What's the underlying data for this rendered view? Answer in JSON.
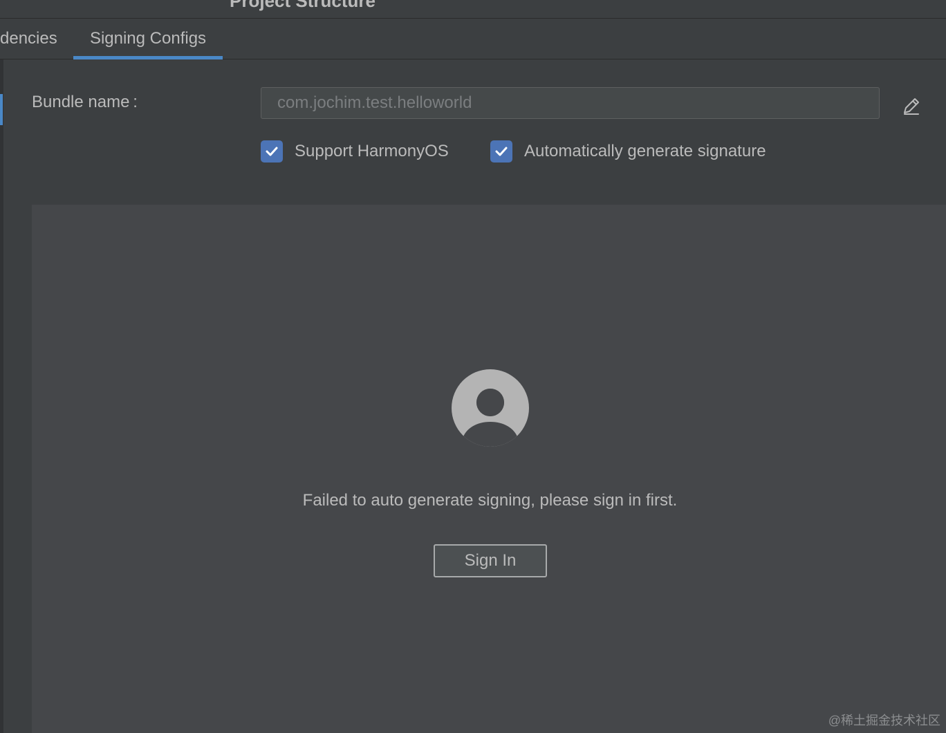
{
  "window": {
    "title": "Project Structure"
  },
  "tabs": [
    {
      "label": "dencies",
      "active": false
    },
    {
      "label": "Signing Configs",
      "active": true
    }
  ],
  "bundle": {
    "label": "Bundle name :",
    "value": "com.jochim.test.helloworld",
    "edit_icon": "pencil-icon"
  },
  "options": {
    "support_harmony": {
      "label": "Support HarmonyOS",
      "checked": true
    },
    "auto_signature": {
      "label": "Automatically generate signature",
      "checked": true
    }
  },
  "signin_panel": {
    "avatar_icon": "user-avatar-icon",
    "message": "Failed to auto generate signing, please sign in first.",
    "button_label": "Sign In"
  },
  "watermark": "@稀土掘金技术社区",
  "colors": {
    "background": "#3c3f41",
    "panel": "#45474a",
    "accent": "#4a88c7",
    "checkbox": "#4c74b6",
    "text": "#bbbbbb"
  }
}
